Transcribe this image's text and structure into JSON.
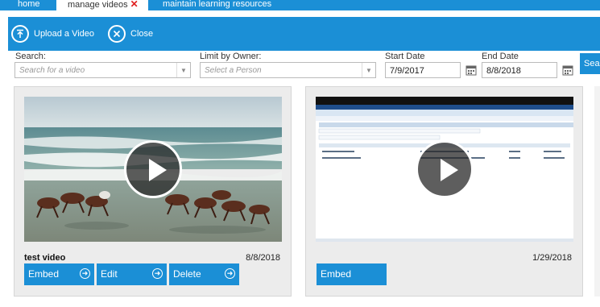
{
  "tabs": [
    {
      "label": "home",
      "active": false
    },
    {
      "label": "manage videos",
      "active": true,
      "close": "✕"
    },
    {
      "label": "maintain learning resources",
      "active": false
    }
  ],
  "toolbar": {
    "upload_label": "Upload a Video",
    "close_label": "Close"
  },
  "filters": {
    "search_label": "Search:",
    "search_placeholder": "Search for a video",
    "owner_label": "Limit by Owner:",
    "owner_placeholder": "Select a Person",
    "start_label": "Start Date",
    "start_value": "7/9/2017",
    "end_label": "End Date",
    "end_value": "8/8/2018",
    "search_button": "Search"
  },
  "videos": [
    {
      "title": "test video",
      "date": "8/8/2018",
      "buttons": [
        "Embed",
        "Edit",
        "Delete"
      ]
    },
    {
      "title": "",
      "date": "1/29/2018",
      "buttons": [
        "Embed"
      ]
    }
  ],
  "colors": {
    "accent": "#1b8fd6",
    "close_x": "#e02020"
  }
}
